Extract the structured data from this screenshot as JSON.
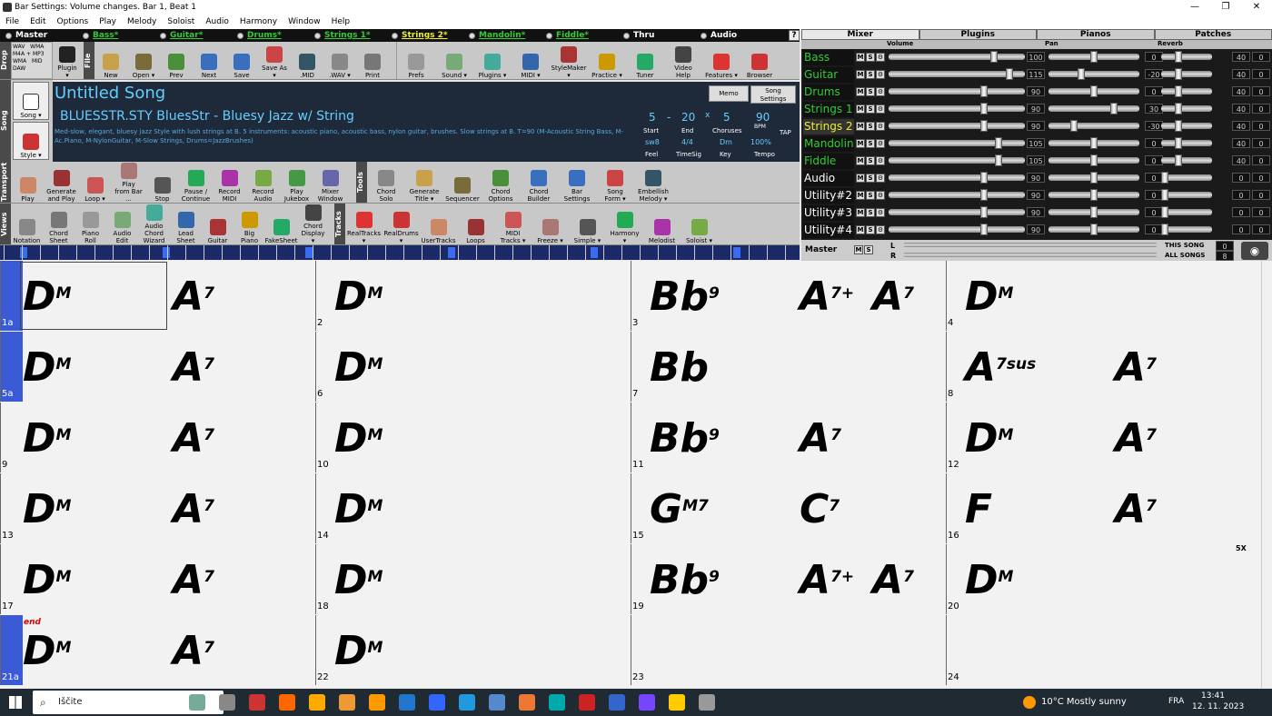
{
  "window": {
    "title": "Bar Settings: Volume changes. Bar 1, Beat 1",
    "min": "—",
    "max": "❐",
    "close": "✕"
  },
  "menu": [
    "File",
    "Edit",
    "Options",
    "Play",
    "Melody",
    "Soloist",
    "Audio",
    "Harmony",
    "Window",
    "Help"
  ],
  "tracks": [
    {
      "n": "Master",
      "c": "#fff"
    },
    {
      "n": "Bass*",
      "c": "#3c3"
    },
    {
      "n": "Guitar*",
      "c": "#3c3"
    },
    {
      "n": "Drums*",
      "c": "#3c3"
    },
    {
      "n": "Strings 1*",
      "c": "#3c3"
    },
    {
      "n": "Strings 2*",
      "c": "#ee3"
    },
    {
      "n": "Mandolin*",
      "c": "#3c3"
    },
    {
      "n": "Fiddle*",
      "c": "#3c3"
    },
    {
      "n": "Thru",
      "c": "#fff"
    },
    {
      "n": "Audio",
      "c": "#fff"
    }
  ],
  "help_q": "?",
  "side": {
    "drop": "Drop",
    "file": "File",
    "song": "Song",
    "transport": "Transport",
    "views": "Views",
    "tools": "Tools",
    "tracksl": "Tracks"
  },
  "drop": {
    "wav": "WAV",
    "wma": "WMA",
    "m4a": "M4A",
    "mp3": "MP3",
    "wma2": "WMA",
    "mid": "MID",
    "daw": "DAW",
    "plugin": "Plugin ▾"
  },
  "file_btns": [
    "New",
    "Open ▾",
    "Prev",
    "Next",
    "Save",
    "Save As ▾",
    ".MID",
    ".WAV ▾",
    "Print"
  ],
  "prefs_btns": [
    "Prefs",
    "Sound ▾",
    "Plugins ▾",
    "MIDI ▾",
    "StyleMaker ▾",
    "Practice ▾",
    "Tuner",
    "Video Help",
    "Features ▾",
    "Browser"
  ],
  "features_year": "2022",
  "features_new": "NEW",
  "song_side": {
    "song": "Song ▾",
    "style": "Style ▾"
  },
  "song": {
    "title": "Untitled Song",
    "memo": "Memo",
    "settings": "Song Settings",
    "style": "BLUESSTR.STY BluesStr - Bluesy Jazz w/ String",
    "desc": "Med-slow, elegant, bluesy jazz Style with lush strings at B. 5 instruments: acoustic piano, acoustic bass, nylon guitar, brushes. Slow strings at B. T=90    (M-Acoustic String Bass, M-Ac.Piano, M-NylonGuitar, M-Slow Strings, Drums=JazzBrushes)",
    "start": "5",
    "dash": "-",
    "end": "20",
    "x": "x",
    "choruses": "5",
    "bpm": "90",
    "bpm_lab": "BPM",
    "start_lab": "Start",
    "end_lab": "End",
    "ch_lab": "Choruses",
    "feel": "sw8",
    "ts": "4/4",
    "key": "Dm",
    "pct": "100%",
    "tap": "TAP",
    "feel_lab": "Feel",
    "ts_lab": "TimeSig",
    "key_lab": "Key",
    "tempo_lab": "Tempo"
  },
  "transport_btns": [
    "Play",
    "Generate and Play",
    "Loop ▾",
    "Play from Bar ...",
    "Stop",
    "Pause / Continue",
    "Record MIDI",
    "Record Audio",
    "Play Jukebox",
    "Mixer Window"
  ],
  "tools_btns": [
    "Chord Solo",
    "Generate Title ▾",
    "Sequencer",
    "Chord Options",
    "Chord Builder",
    "Bar Settings",
    "Song Form ▾",
    "Embellish Melody ▾"
  ],
  "views_btns": [
    "Notation",
    "Chord Sheet",
    "Piano Roll",
    "Audio Edit",
    "Audio Chord Wizard",
    "Lead Sheet",
    "Guitar",
    "Big Piano",
    "FakeSheet",
    "Chord Display ▾"
  ],
  "tracks_btns": [
    "RealTracks ▾",
    "RealDrums ▾",
    "UserTracks",
    "Loops",
    "MIDI Tracks ▾",
    "Freeze ▾",
    "Simple ▾",
    "Harmony ▾",
    "Melodist",
    "Soloist ▾"
  ],
  "mixer": {
    "tabs": [
      "Mixer",
      "Plugins",
      "Pianos",
      "Patches"
    ],
    "cols": [
      "Volume",
      "Pan",
      "Reverb"
    ],
    "rows": [
      {
        "n": "Bass",
        "c": "#3c3",
        "v": "100",
        "p": "0",
        "r": "40",
        "t": "0"
      },
      {
        "n": "Guitar",
        "c": "#3c3",
        "v": "115",
        "p": "-20",
        "r": "40",
        "t": "0"
      },
      {
        "n": "Drums",
        "c": "#3c3",
        "v": "90",
        "p": "0",
        "r": "40",
        "t": "0"
      },
      {
        "n": "Strings 1",
        "c": "#3c3",
        "v": "90",
        "p": "30",
        "r": "40",
        "t": "0"
      },
      {
        "n": "Strings 2",
        "c": "#ee3",
        "v": "90",
        "p": "-30",
        "r": "40",
        "t": "0"
      },
      {
        "n": "Mandolin",
        "c": "#3c3",
        "v": "105",
        "p": "0",
        "r": "40",
        "t": "0"
      },
      {
        "n": "Fiddle",
        "c": "#3c3",
        "v": "105",
        "p": "0",
        "r": "40",
        "t": "0"
      },
      {
        "n": "Audio",
        "c": "#fff",
        "v": "90",
        "p": "0",
        "r": "0",
        "t": "0"
      },
      {
        "n": "Utility#2",
        "c": "#fff",
        "v": "90",
        "p": "0",
        "r": "0",
        "t": "0"
      },
      {
        "n": "Utility#3",
        "c": "#fff",
        "v": "90",
        "p": "0",
        "r": "0",
        "t": "0"
      },
      {
        "n": "Utility#4",
        "c": "#fff",
        "v": "90",
        "p": "0",
        "r": "0",
        "t": "0"
      }
    ],
    "master": "Master",
    "l": "L",
    "r": "R",
    "this_song": "THIS SONG",
    "all_songs": "ALL SONGS",
    "this_val": "0",
    "all_val": "8"
  },
  "sheet": {
    "rows": [
      [
        {
          "num": "1a",
          "ch": [
            {
              "r": "D",
              "s": "M"
            },
            {
              "r": "A",
              "s": "7"
            }
          ]
        },
        {
          "num": "2",
          "ch": [
            {
              "r": "D",
              "s": "M"
            }
          ]
        },
        {
          "num": "3",
          "ch": [
            {
              "r": "Bb",
              "s": "9"
            },
            {
              "r": "A",
              "s": "7+"
            },
            {
              "r": "A",
              "s": "7"
            }
          ]
        },
        {
          "num": "4",
          "ch": [
            {
              "r": "D",
              "s": "M"
            }
          ]
        }
      ],
      [
        {
          "num": "5a",
          "ch": [
            {
              "r": "D",
              "s": "M"
            },
            {
              "r": "A",
              "s": "7"
            }
          ]
        },
        {
          "num": "6",
          "ch": [
            {
              "r": "D",
              "s": "M"
            }
          ]
        },
        {
          "num": "7",
          "ch": [
            {
              "r": "Bb",
              "s": ""
            }
          ]
        },
        {
          "num": "8",
          "ch": [
            {
              "r": "A",
              "s": "7sus"
            },
            {
              "r": "A",
              "s": "7"
            }
          ]
        }
      ],
      [
        {
          "num": "9",
          "ch": [
            {
              "r": "D",
              "s": "M"
            },
            {
              "r": "A",
              "s": "7"
            }
          ]
        },
        {
          "num": "10",
          "ch": [
            {
              "r": "D",
              "s": "M"
            }
          ]
        },
        {
          "num": "11",
          "ch": [
            {
              "r": "Bb",
              "s": "9"
            },
            {
              "r": "A",
              "s": "7"
            }
          ]
        },
        {
          "num": "12",
          "ch": [
            {
              "r": "D",
              "s": "M"
            },
            {
              "r": "A",
              "s": "7"
            }
          ]
        }
      ],
      [
        {
          "num": "13",
          "ch": [
            {
              "r": "D",
              "s": "M"
            },
            {
              "r": "A",
              "s": "7"
            }
          ]
        },
        {
          "num": "14",
          "ch": [
            {
              "r": "D",
              "s": "M"
            }
          ]
        },
        {
          "num": "15",
          "ch": [
            {
              "r": "G",
              "s": "M7"
            },
            {
              "r": "C",
              "s": "7"
            }
          ]
        },
        {
          "num": "16",
          "ch": [
            {
              "r": "F",
              "s": ""
            },
            {
              "r": "A",
              "s": "7"
            }
          ]
        }
      ],
      [
        {
          "num": "17",
          "ch": [
            {
              "r": "D",
              "s": "M"
            },
            {
              "r": "A",
              "s": "7"
            }
          ]
        },
        {
          "num": "18",
          "ch": [
            {
              "r": "D",
              "s": "M"
            }
          ]
        },
        {
          "num": "19",
          "ch": [
            {
              "r": "Bb",
              "s": "9"
            },
            {
              "r": "A",
              "s": "7+"
            },
            {
              "r": "A",
              "s": "7"
            }
          ]
        },
        {
          "num": "20",
          "ch": [
            {
              "r": "D",
              "s": "M"
            }
          ]
        }
      ],
      [
        {
          "num": "21a",
          "ch": [
            {
              "r": "D",
              "s": "M"
            },
            {
              "r": "A",
              "s": "7"
            }
          ]
        },
        {
          "num": "22",
          "ch": [
            {
              "r": "D",
              "s": "M"
            }
          ]
        },
        {
          "num": "23",
          "ch": []
        },
        {
          "num": "24",
          "ch": []
        }
      ]
    ],
    "end_label": "end",
    "sx": "5X"
  },
  "taskbar": {
    "search": "Iščite",
    "weather": "10°C  Mostly sunny",
    "lang": "FRA",
    "time": "13:41",
    "date": "12. 11. 2023"
  }
}
